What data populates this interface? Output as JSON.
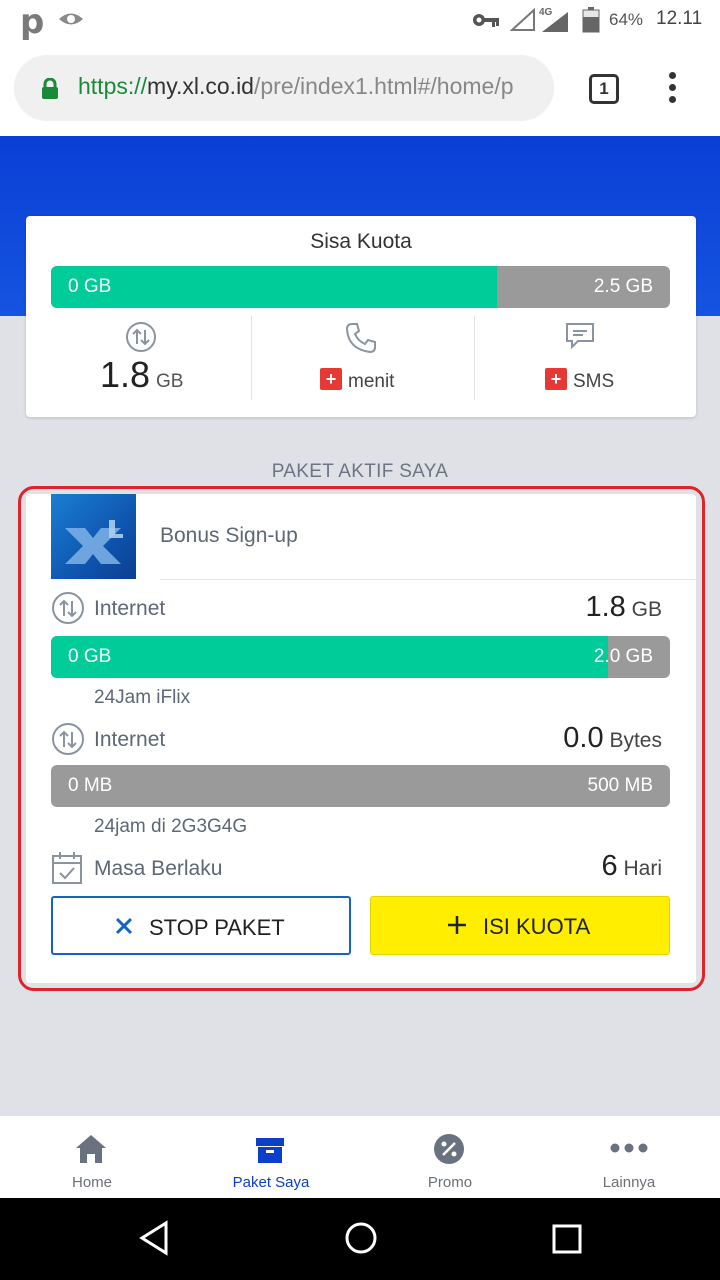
{
  "status_bar": {
    "app_letter": "p",
    "network": "4G",
    "battery": "64%",
    "time": "12.11"
  },
  "browser": {
    "url_scheme": "https://",
    "url_host": "my.xl.co.id",
    "url_path": "/pre/index1.html#/home/p",
    "tab_count": "1"
  },
  "summary": {
    "title": "Sisa Kuota",
    "bar_left": "0 GB",
    "bar_right": "2.5 GB",
    "bar_fill_fraction": 0.72,
    "data_value": "1.8",
    "data_unit": "GB",
    "voice_label": "menit",
    "sms_label": "SMS",
    "plus": "+"
  },
  "section_title": "PAKET AKTIF SAYA",
  "package": {
    "name": "Bonus Sign-up",
    "rows": [
      {
        "label": "Internet",
        "value": "1.8",
        "unit": "GB",
        "bar_left": "0 GB",
        "bar_right": "2.0 GB",
        "bar_fill_fraction": 0.9,
        "note": "24Jam iFlix"
      },
      {
        "label": "Internet",
        "value": "0.0",
        "unit": "Bytes",
        "bar_left": "0 MB",
        "bar_right": "500 MB",
        "bar_fill_fraction": 0.0,
        "note": "24jam di 2G3G4G"
      }
    ],
    "validity_label": "Masa Berlaku",
    "validity_value": "6",
    "validity_unit": "Hari",
    "stop_label": "STOP PAKET",
    "isi_label": "ISI KUOTA"
  },
  "bottom_nav": {
    "items": [
      {
        "label": "Home",
        "icon": "home-icon"
      },
      {
        "label": "Paket Saya",
        "icon": "box-icon"
      },
      {
        "label": "Promo",
        "icon": "promo-icon"
      },
      {
        "label": "Lainnya",
        "icon": "more-icon"
      }
    ],
    "active_index": 1
  },
  "colors": {
    "brand_blue": "#0a3fd6",
    "quota_green": "#00cc99",
    "highlight_red": "#e0222a",
    "isi_yellow": "#ffee00"
  }
}
